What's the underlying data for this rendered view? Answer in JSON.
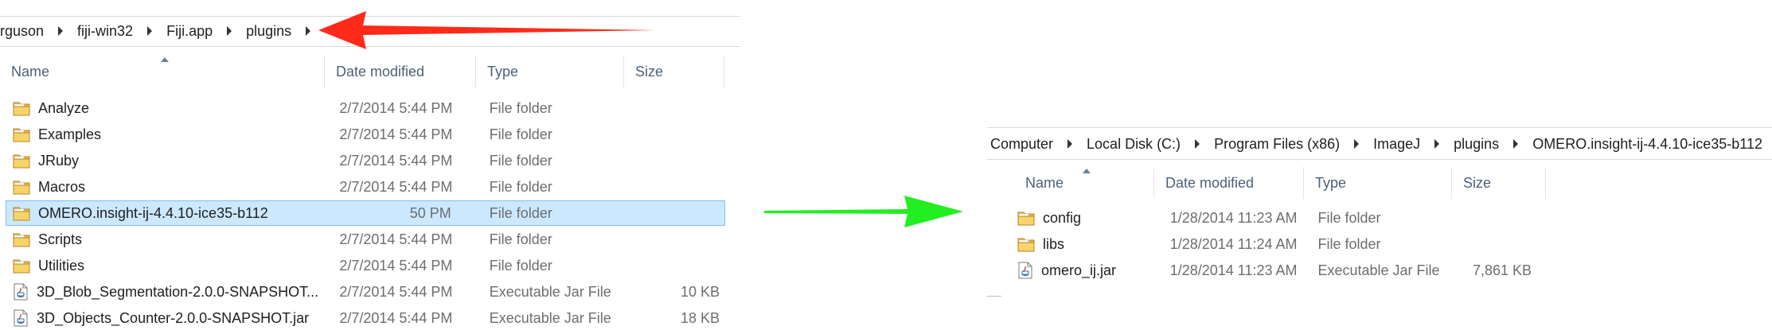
{
  "left": {
    "breadcrumb": [
      "rguson",
      "fiji-win32",
      "Fiji.app",
      "plugins"
    ],
    "columns": {
      "name": "Name",
      "date": "Date modified",
      "type": "Type",
      "size": "Size"
    },
    "rows": [
      {
        "name": "Analyze",
        "date": "2/7/2014 5:44 PM",
        "type": "File folder",
        "size": "",
        "icon": "folder-icon"
      },
      {
        "name": "Examples",
        "date": "2/7/2014 5:44 PM",
        "type": "File folder",
        "size": "",
        "icon": "folder-icon"
      },
      {
        "name": "JRuby",
        "date": "2/7/2014 5:44 PM",
        "type": "File folder",
        "size": "",
        "icon": "folder-icon"
      },
      {
        "name": "Macros",
        "date": "2/7/2014 5:44 PM",
        "type": "File folder",
        "size": "",
        "icon": "folder-icon"
      },
      {
        "name": "OMERO.insight-ij-4.4.10-ice35-b112",
        "date": "50 PM",
        "type": "File folder",
        "size": "",
        "icon": "folder-icon",
        "selected": true
      },
      {
        "name": "Scripts",
        "date": "2/7/2014 5:44 PM",
        "type": "File folder",
        "size": "",
        "icon": "folder-icon"
      },
      {
        "name": "Utilities",
        "date": "2/7/2014 5:44 PM",
        "type": "File folder",
        "size": "",
        "icon": "folder-icon"
      },
      {
        "name": "3D_Blob_Segmentation-2.0.0-SNAPSHOT...",
        "date": "2/7/2014 5:44 PM",
        "type": "Executable Jar File",
        "size": "10 KB",
        "icon": "jar-icon"
      },
      {
        "name": "3D_Objects_Counter-2.0.0-SNAPSHOT.jar",
        "date": "2/7/2014 5:44 PM",
        "type": "Executable Jar File",
        "size": "18 KB",
        "icon": "jar-icon"
      }
    ]
  },
  "right": {
    "breadcrumb": [
      "Computer",
      "Local Disk (C:)",
      "Program Files (x86)",
      "ImageJ",
      "plugins",
      "OMERO.insight-ij-4.4.10-ice35-b112"
    ],
    "columns": {
      "name": "Name",
      "date": "Date modified",
      "type": "Type",
      "size": "Size"
    },
    "rows": [
      {
        "name": "config",
        "date": "1/28/2014 11:23 AM",
        "type": "File folder",
        "size": "",
        "icon": "folder-icon"
      },
      {
        "name": "libs",
        "date": "1/28/2014 11:24 AM",
        "type": "File folder",
        "size": "",
        "icon": "folder-icon"
      },
      {
        "name": "omero_ij.jar",
        "date": "1/28/2014 11:23 AM",
        "type": "Executable Jar File",
        "size": "7,861 KB",
        "icon": "jar-icon"
      }
    ]
  },
  "annotations": {
    "red_arrow_color": "#ff2a1a",
    "green_arrow_color": "#22ee22"
  }
}
